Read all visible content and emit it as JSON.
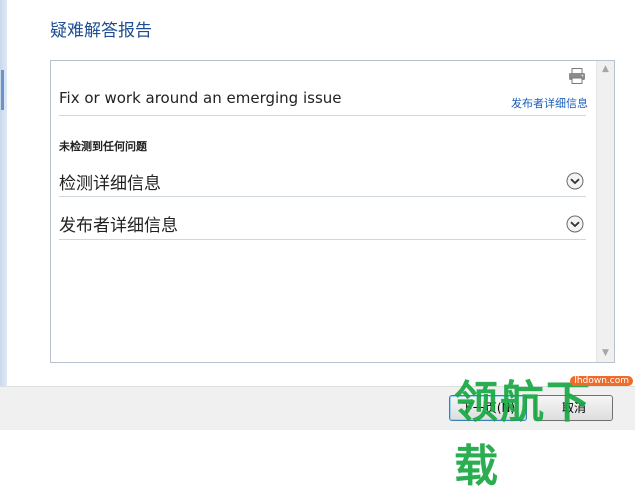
{
  "header": {
    "title": "疑难解答报告"
  },
  "report": {
    "issue_title": "Fix or work around an emerging issue",
    "publisher_link": "发布者详细信息",
    "status": "未检测到任何问题",
    "sections": [
      {
        "label": "检测详细信息"
      },
      {
        "label": "发布者详细信息"
      }
    ]
  },
  "footer": {
    "next_label": "下一页(N)",
    "cancel_label": "取消"
  },
  "watermark": {
    "text": "领航下载",
    "site": "lhdown.com"
  },
  "icons": {
    "print": "printer-icon",
    "expand": "chevron-down-circle-icon",
    "scroll_up": "scroll-up-arrow-icon",
    "scroll_down": "scroll-down-arrow-icon"
  },
  "colors": {
    "title": "#1e4d92",
    "link": "#1c5fb9",
    "watermark_green": "#18a843",
    "watermark_orange": "#ef6b2a"
  }
}
